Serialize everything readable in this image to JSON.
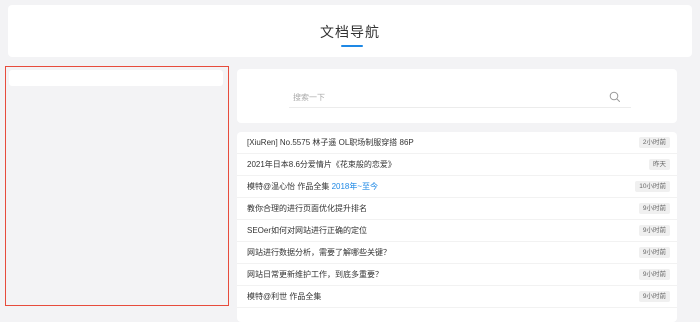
{
  "header": {
    "title": "文档导航"
  },
  "search": {
    "placeholder": "搜索一下",
    "value": ""
  },
  "articles": [
    {
      "title": "[XiuRen] No.5575 林子遥 OL职场制服穿搭 86P",
      "highlight": "",
      "time": "2小时前"
    },
    {
      "title": "2021年日本8.6分爱情片《花束般的恋爱》",
      "highlight": "",
      "time": "昨天"
    },
    {
      "title": "模特@温心怡 作品全集 ",
      "highlight": "2018年~至今",
      "time": "10小时前"
    },
    {
      "title": "教你合理的进行页面优化提升排名",
      "highlight": "",
      "time": "9小时前"
    },
    {
      "title": "SEOer如何对网站进行正确的定位",
      "highlight": "",
      "time": "9小时前"
    },
    {
      "title": "网站进行数据分析，需要了解哪些关键？",
      "highlight": "",
      "time": "9小时前"
    },
    {
      "title": "网站日常更新维护工作，到底多重要？",
      "highlight": "",
      "time": "9小时前"
    },
    {
      "title": "模特@利世 作品全集",
      "highlight": "",
      "time": "9小时前"
    }
  ],
  "colors": {
    "accent": "#1e88e5",
    "sidebar_border": "#e74c3c"
  }
}
